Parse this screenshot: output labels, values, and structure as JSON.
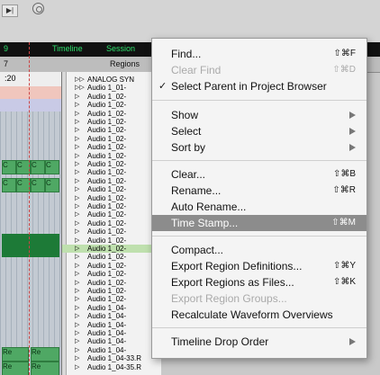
{
  "toolbar": {
    "play_label": "▶|",
    "circle_icon": "record-circle-icon"
  },
  "header": {
    "tab_timeline": "Timeline",
    "tab_session": "Session",
    "regions_label": "Regions",
    "left_number": "7",
    "timecode": ":20",
    "tab_fragment": "9"
  },
  "regions": {
    "items": [
      "ANALOG SYN",
      "Audio 1_01-",
      "Audio 1_02-",
      "Audio 1_02-",
      "Audio 1_02-",
      "Audio 1_02-",
      "Audio 1_02-",
      "Audio 1_02-",
      "Audio 1_02-",
      "Audio 1_02-",
      "Audio 1_02-",
      "Audio 1_02-",
      "Audio 1_02-",
      "Audio 1_02-",
      "Audio 1_02-",
      "Audio 1_02-",
      "Audio 1_02-",
      "Audio 1_02-",
      "Audio 1_02-",
      "Audio 1_02-",
      "Audio 1_02-",
      "Audio 1_02-",
      "Audio 1_02-",
      "Audio 1_02-",
      "Audio 1_02-",
      "Audio 1_02-",
      "Audio 1_02-",
      "Audio 1_04-",
      "Audio 1_04-",
      "Audio 1_04-",
      "Audio 1_04-",
      "Audio 1_04-",
      "Audio 1_04-",
      "Audio 1_04-33.R",
      "Audio 1_04-35.R"
    ]
  },
  "timeline": {
    "clip_label_1": "C",
    "clip_label_2": "Re"
  },
  "menu": {
    "find": "Find...",
    "find_sc": "⇧⌘F",
    "clear_find": "Clear Find",
    "clear_find_sc": "⇧⌘D",
    "select_parent": "Select Parent in Project Browser",
    "show": "Show",
    "select": "Select",
    "sort_by": "Sort by",
    "clear": "Clear...",
    "clear_sc": "⇧⌘B",
    "rename": "Rename...",
    "rename_sc": "⇧⌘R",
    "auto_rename": "Auto Rename...",
    "time_stamp": "Time Stamp...",
    "time_stamp_sc": "⇧⌘M",
    "compact": "Compact...",
    "export_defs": "Export Region Definitions...",
    "export_defs_sc": "⇧⌘Y",
    "export_files": "Export Regions as Files...",
    "export_files_sc": "⇧⌘K",
    "export_groups": "Export Region Groups...",
    "recalc": "Recalculate Waveform Overviews",
    "drop_order": "Timeline Drop Order"
  }
}
